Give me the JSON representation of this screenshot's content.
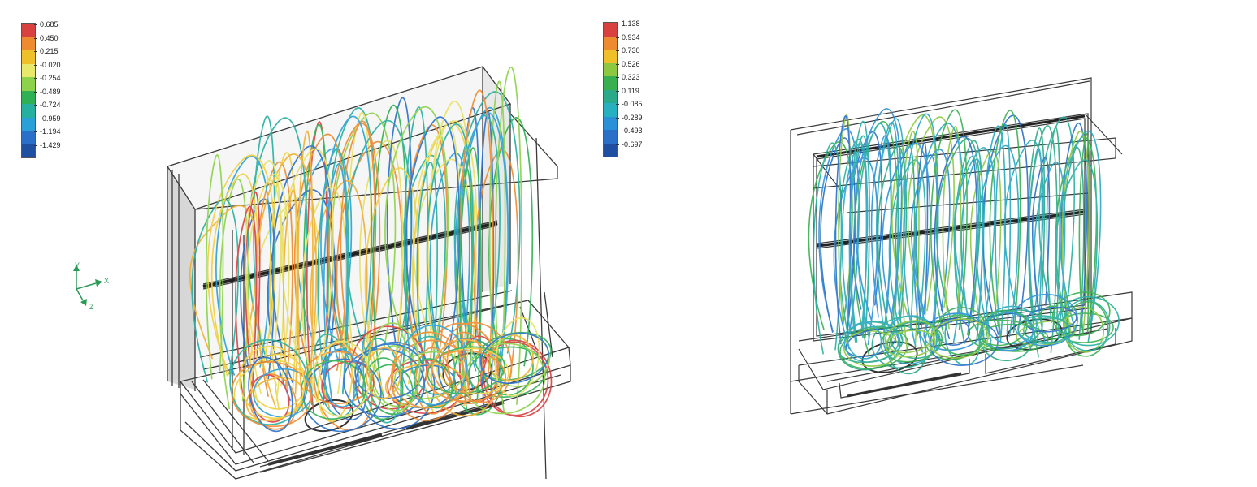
{
  "figures": [
    {
      "id": "left",
      "legend": {
        "labels": [
          "0.685",
          "0.450",
          "0.215",
          "-0.020",
          "-0.254",
          "-0.489",
          "-0.724",
          "-0.959",
          "-1.194",
          "-1.429"
        ],
        "colors": [
          "#d94040",
          "#ee8a30",
          "#f0c02a",
          "#e8e86a",
          "#8cd24a",
          "#2fb055",
          "#26b0a0",
          "#2aa0d8",
          "#2a6fc8",
          "#1e4fa0"
        ]
      }
    },
    {
      "id": "right",
      "legend": {
        "labels": [
          "1.138",
          "0.934",
          "0.730",
          "0.526",
          "0.323",
          "0.119",
          "-0.085",
          "-0.289",
          "-0.493",
          "-0.697"
        ],
        "colors": [
          "#d94040",
          "#ee8a30",
          "#f0c02a",
          "#8cc840",
          "#38b050",
          "#2aaa88",
          "#26b0c0",
          "#2a90d8",
          "#2a6fc8",
          "#1e4fa0"
        ]
      }
    }
  ],
  "axis_triad": {
    "x": "X",
    "y": "Y",
    "z": "Z"
  },
  "streamline_colors": {
    "left": [
      "#e8e060",
      "#f0d040",
      "#f0b030",
      "#ee8a30",
      "#d94040",
      "#8cd24a",
      "#2fb055",
      "#26b0a0",
      "#2aa0d8",
      "#2a6fc8"
    ],
    "right": [
      "#2aaa88",
      "#26b0a0",
      "#26a8c0",
      "#2a90d8",
      "#38b050",
      "#8cc840",
      "#2a6fc8"
    ]
  }
}
